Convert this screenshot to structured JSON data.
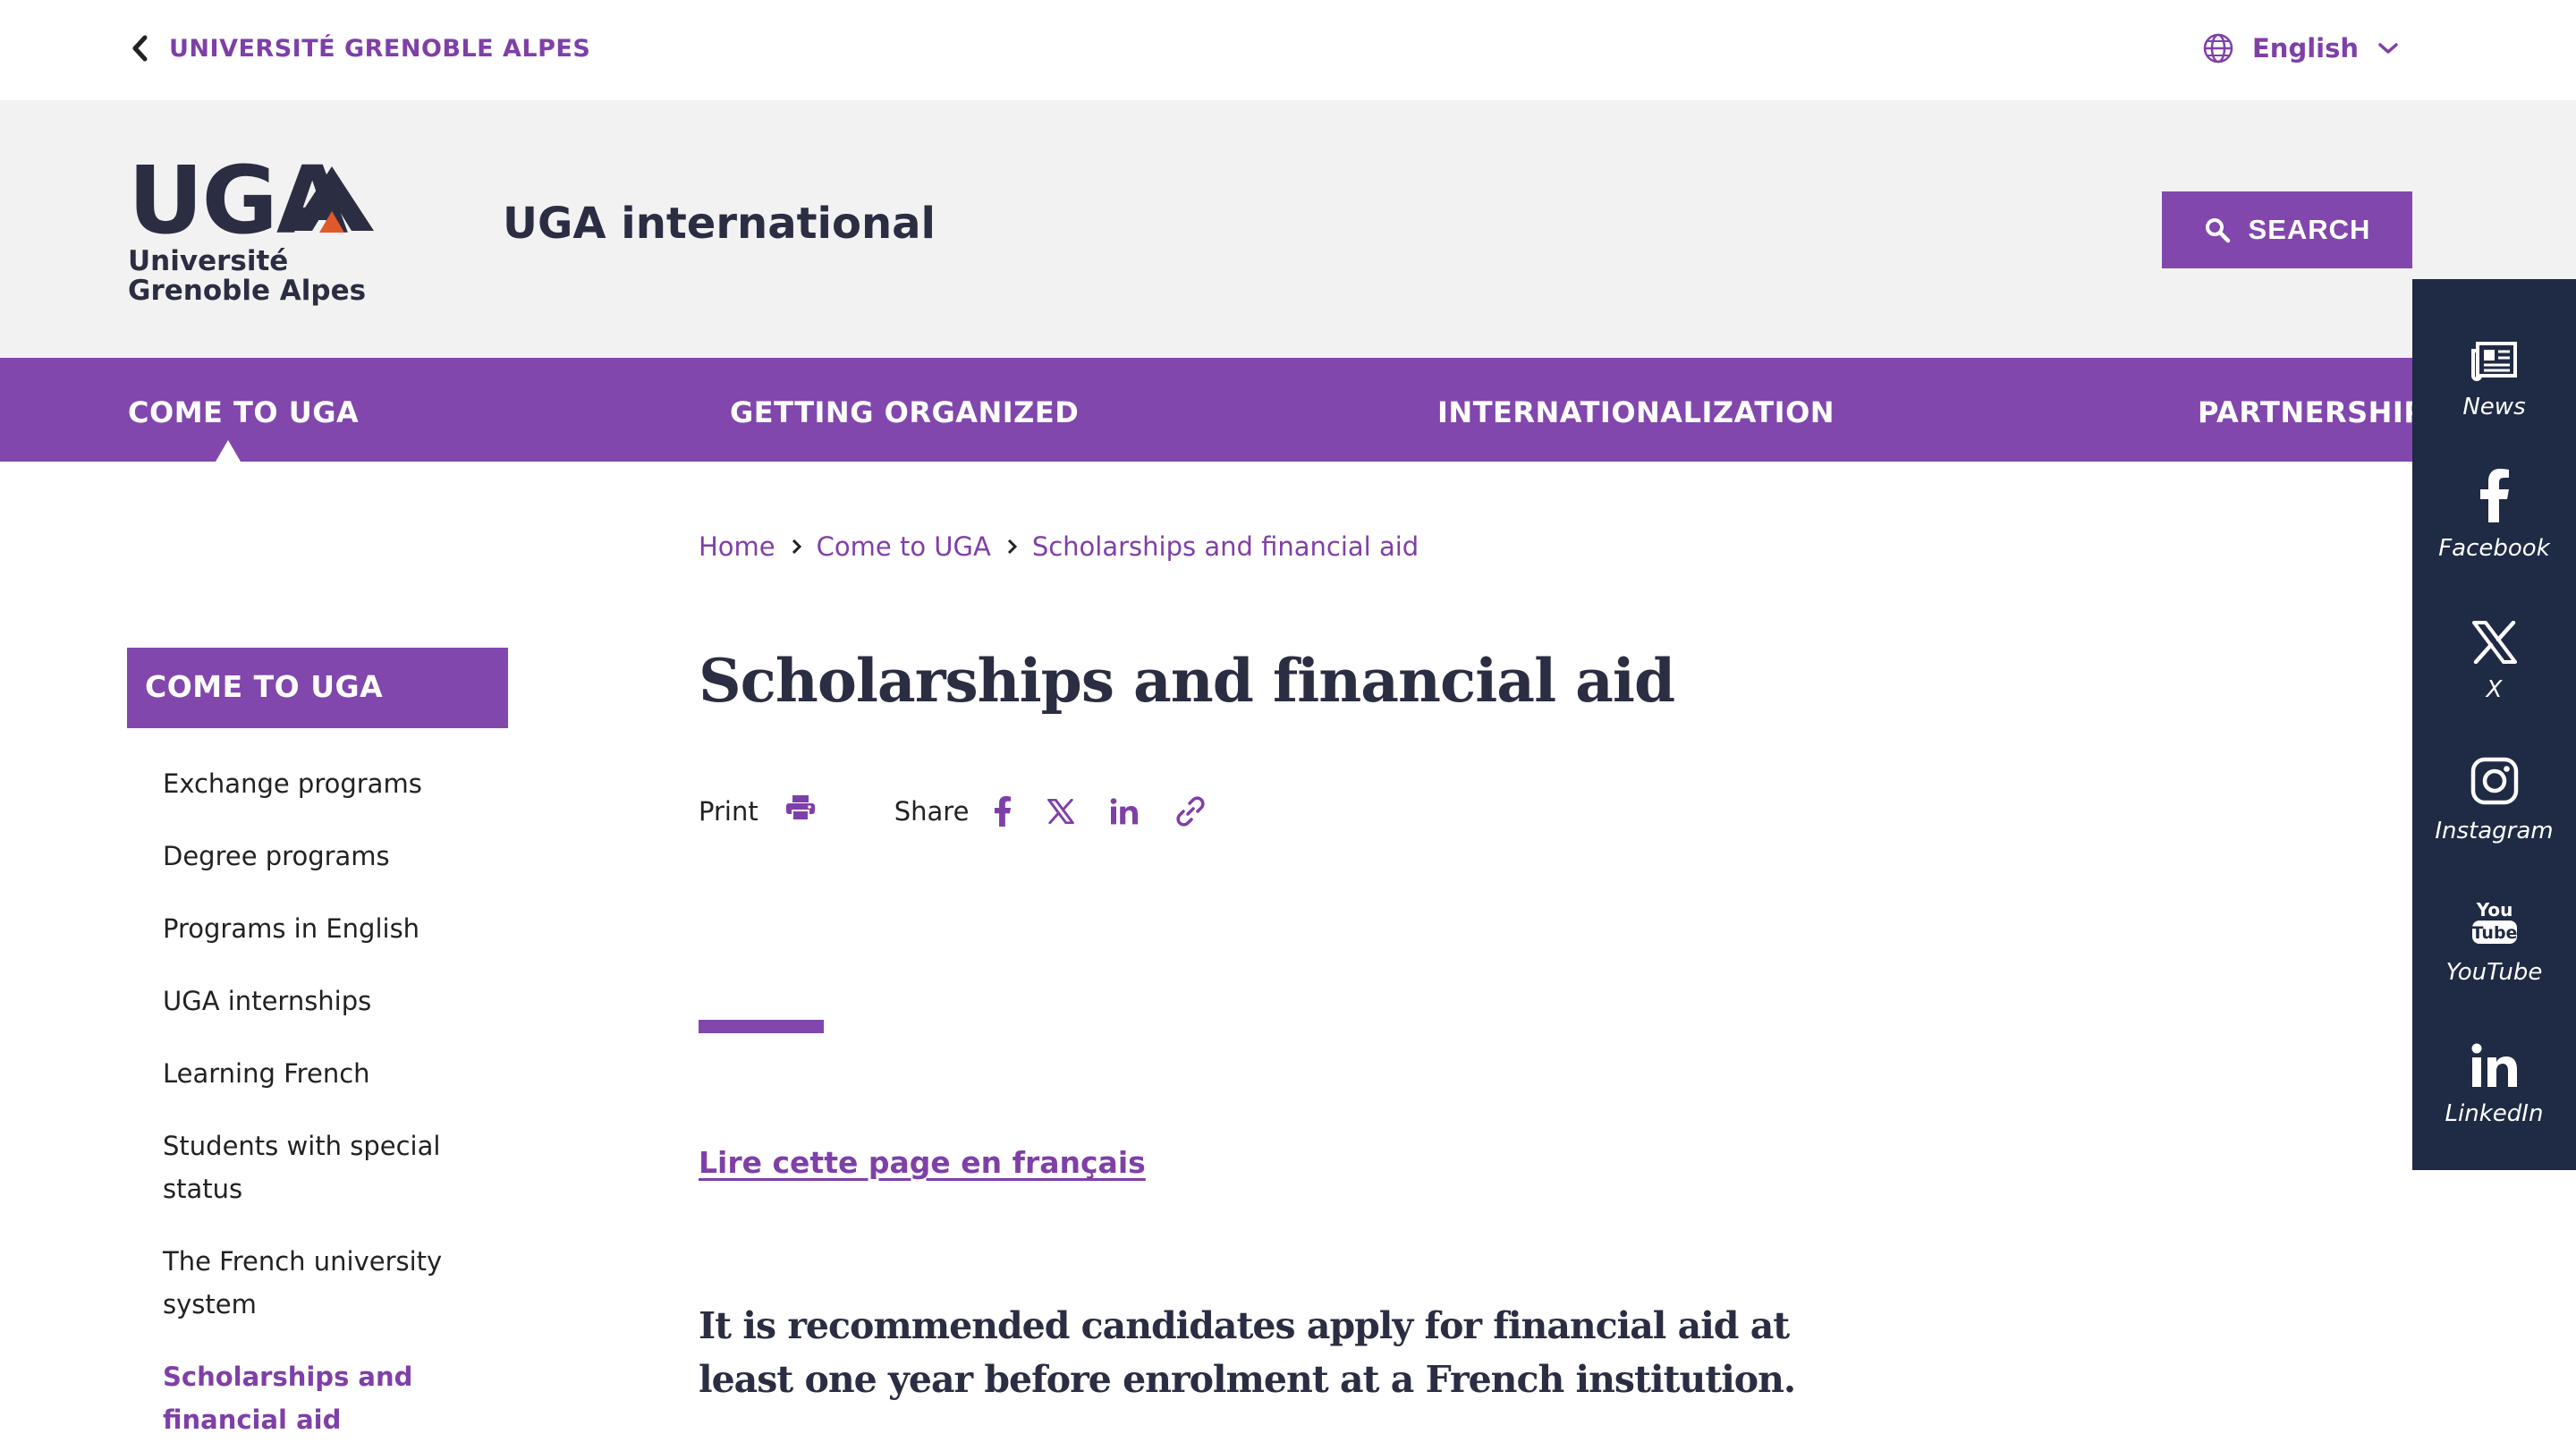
{
  "topbar": {
    "back_label": "UNIVERSITÉ GRENOBLE ALPES",
    "language_label": "English"
  },
  "header": {
    "logo_main": "UGA",
    "logo_line1": "Université",
    "logo_line2": "Grenoble Alpes",
    "site_title": "UGA international",
    "search_label": "SEARCH"
  },
  "nav": {
    "items": [
      {
        "label": "COME TO UGA",
        "active": true
      },
      {
        "label": "GETTING ORGANIZED"
      },
      {
        "label": "INTERNATIONALIZATION"
      },
      {
        "label": "PARTNERSHIPS"
      }
    ]
  },
  "rail": {
    "items": [
      {
        "label": "News",
        "icon": "news-icon"
      },
      {
        "label": "Facebook",
        "icon": "facebook-icon"
      },
      {
        "label": "X",
        "icon": "x-icon"
      },
      {
        "label": "Instagram",
        "icon": "instagram-icon"
      },
      {
        "label": "YouTube",
        "icon": "youtube-icon"
      },
      {
        "label": "LinkedIn",
        "icon": "linkedin-icon"
      }
    ]
  },
  "breadcrumb": [
    "Home",
    "Come to UGA",
    "Scholarships and financial aid"
  ],
  "sidebar": {
    "heading": "COME TO UGA",
    "items": [
      {
        "label": "Exchange programs"
      },
      {
        "label": "Degree programs"
      },
      {
        "label": "Programs in English"
      },
      {
        "label": "UGA internships"
      },
      {
        "label": "Learning French"
      },
      {
        "label": "Students with special status"
      },
      {
        "label": "The French university system"
      },
      {
        "label": "Scholarships and financial aid",
        "active": true
      }
    ]
  },
  "content": {
    "title": "Scholarships and financial aid",
    "print_label": "Print",
    "share_label": "Share",
    "french_link": "Lire cette page en français",
    "lead": "It is recommended candidates apply for financial aid at least one year before enrolment at a French institution."
  },
  "colors": {
    "accent": "#8147ad",
    "rail_bg": "#1f2a44",
    "header_bg": "#f2f2f2",
    "logo_orange": "#e0592a"
  }
}
